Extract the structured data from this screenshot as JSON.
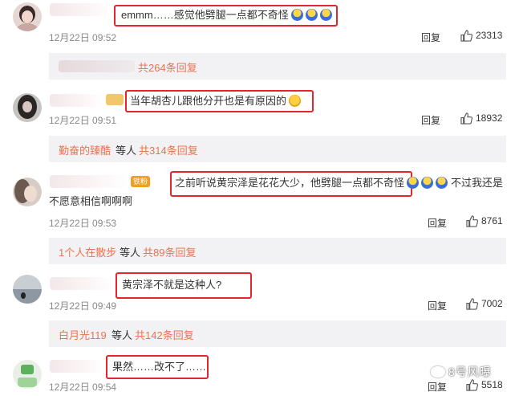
{
  "comments": [
    {
      "text": "emmm……感觉他劈腿一点都不奇怪",
      "time": "12月22日 09:52",
      "reply": "回复",
      "likes": "23313",
      "sub": {
        "who": "",
        "mid": "",
        "count": "共264条回复"
      }
    },
    {
      "text": "当年胡杏儿跟他分开也是有原因的",
      "time": "12月22日 09:51",
      "reply": "回复",
      "likes": "18932",
      "sub": {
        "who": "勤奋的臻酷",
        "mid": "等人",
        "count": "共314条回复"
      }
    },
    {
      "badge": "铁粉",
      "text": "之前听说黄宗泽是花花大少，他劈腿一点都不奇怪",
      "text_tail": "不过我还是",
      "text_line2": "不愿意相信啊啊啊",
      "time": "12月22日 09:53",
      "reply": "回复",
      "likes": "8761",
      "sub": {
        "who": "1个人在散步",
        "mid": "等人",
        "count": "共89条回复"
      }
    },
    {
      "text": "黄宗泽不就是这种人?",
      "time": "12月22日 09:49",
      "reply": "回复",
      "likes": "7002",
      "sub": {
        "who": "白月光119",
        "mid": "等人",
        "count": "共142条回复"
      }
    },
    {
      "text": "果然……改不了……",
      "time": "12月22日 09:54",
      "reply": "回复",
      "likes": "5518"
    }
  ],
  "watermark": "8号风曝",
  "colors": {
    "highlight": "#e3262b",
    "link": "#eb7350",
    "subBg": "#f2f2f5"
  },
  "icons": {
    "like": "thumbs-up-icon",
    "emoji_cry": "crying-face-emoji",
    "emoji_laugh": "laughing-face-emoji"
  }
}
